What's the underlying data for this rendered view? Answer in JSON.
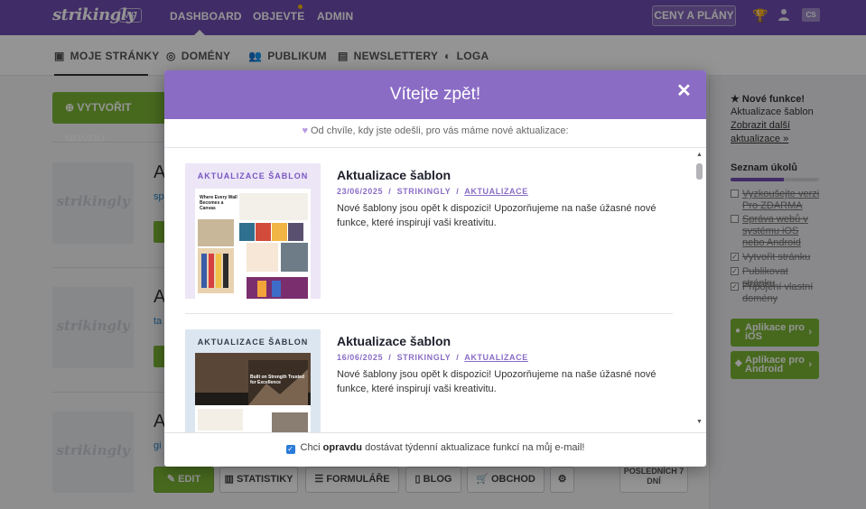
{
  "topbar": {
    "logo": "strikingly",
    "badge": "VIP",
    "nav": [
      "DASHBOARD",
      "OBJEVTE",
      "ADMIN"
    ],
    "pricing": "CENY A PLÁNY",
    "lang": "CS"
  },
  "subnav": {
    "items": [
      "MOJE STRÁNKY",
      "DOMÉNY",
      "PUBLIKUM",
      "NEWSLETTERY",
      "LOGA"
    ]
  },
  "dashboard": {
    "create_button": "VYTVOŘIT NOVOU",
    "sites": [
      {
        "placeholder": "strikingly",
        "title": "A",
        "link": "sp"
      },
      {
        "placeholder": "strikingly",
        "title": "A",
        "link": "ta"
      },
      {
        "placeholder": "strikingly",
        "title": "A",
        "link": "gi"
      }
    ],
    "buttons": {
      "edit": "EDIT",
      "stats": "STATISTIKY",
      "forms": "FORMULÁŘE",
      "blog": "BLOG",
      "shop": "OBCHOD"
    },
    "last_days": "POSLEDNÍCH 7 DNÍ"
  },
  "sidebar": {
    "new_features_title": "Nové funkce!",
    "new_features_text": "Aktualizace šablon",
    "new_features_link": "Zobrazit další aktualizace »",
    "tasks_title": "Seznam úkolů",
    "tasks_progress": 0.6,
    "tasks": [
      {
        "label": "Vyzkoušejte verzi Pro ZDARMA",
        "done": false
      },
      {
        "label": "Správa webů v systému iOS nebo Android",
        "done": false
      },
      {
        "label": "Vytvořit stránku",
        "done": true
      },
      {
        "label": "Publikovat stránku",
        "done": true
      },
      {
        "label": "Připojení vlastní domény",
        "done": true
      }
    ],
    "apps": [
      "Aplikace pro iOS",
      "Aplikace pro Android"
    ]
  },
  "modal": {
    "title": "Vítejte zpět!",
    "subtitle": "Od chvíle, kdy jste odešli, pro vás máme nové aktualizace:",
    "posts": [
      {
        "thumb_label": "AKTUALIZACE ŠABLON",
        "thumb_headline": "Where Every Wall Becomes a Canvas",
        "title": "Aktualizace šablon",
        "date": "23/06/2025",
        "author": "STRIKINGLY",
        "category": "AKTUALIZACE",
        "body": "Nové šablony jsou opět k dispozici! Upozorňujeme na naše úžasné nové funkce, které inspirují vaši kreativitu."
      },
      {
        "thumb_label": "AKTUALIZACE ŠABLON",
        "thumb_headline": "Built on Strength Trusted for Excellence",
        "title": "Aktualizace šablon",
        "date": "16/06/2025",
        "author": "STRIKINGLY",
        "category": "AKTUALIZACE",
        "body": "Nové šablony jsou opět k dispozici! Upozorňujeme na naše úžasné nové funkce, které inspirují vaši kreativitu."
      }
    ],
    "footer": {
      "prefix": "Chci",
      "bold": "opravdu",
      "suffix": "dostávat týdenní aktualizace funkcí na můj e-mail!",
      "checked": true
    }
  },
  "colors": {
    "topbar": "#6e4db0",
    "modal_header": "#8a6cc5",
    "accent_green": "#7ab535",
    "link_blue": "#2b84c6"
  }
}
